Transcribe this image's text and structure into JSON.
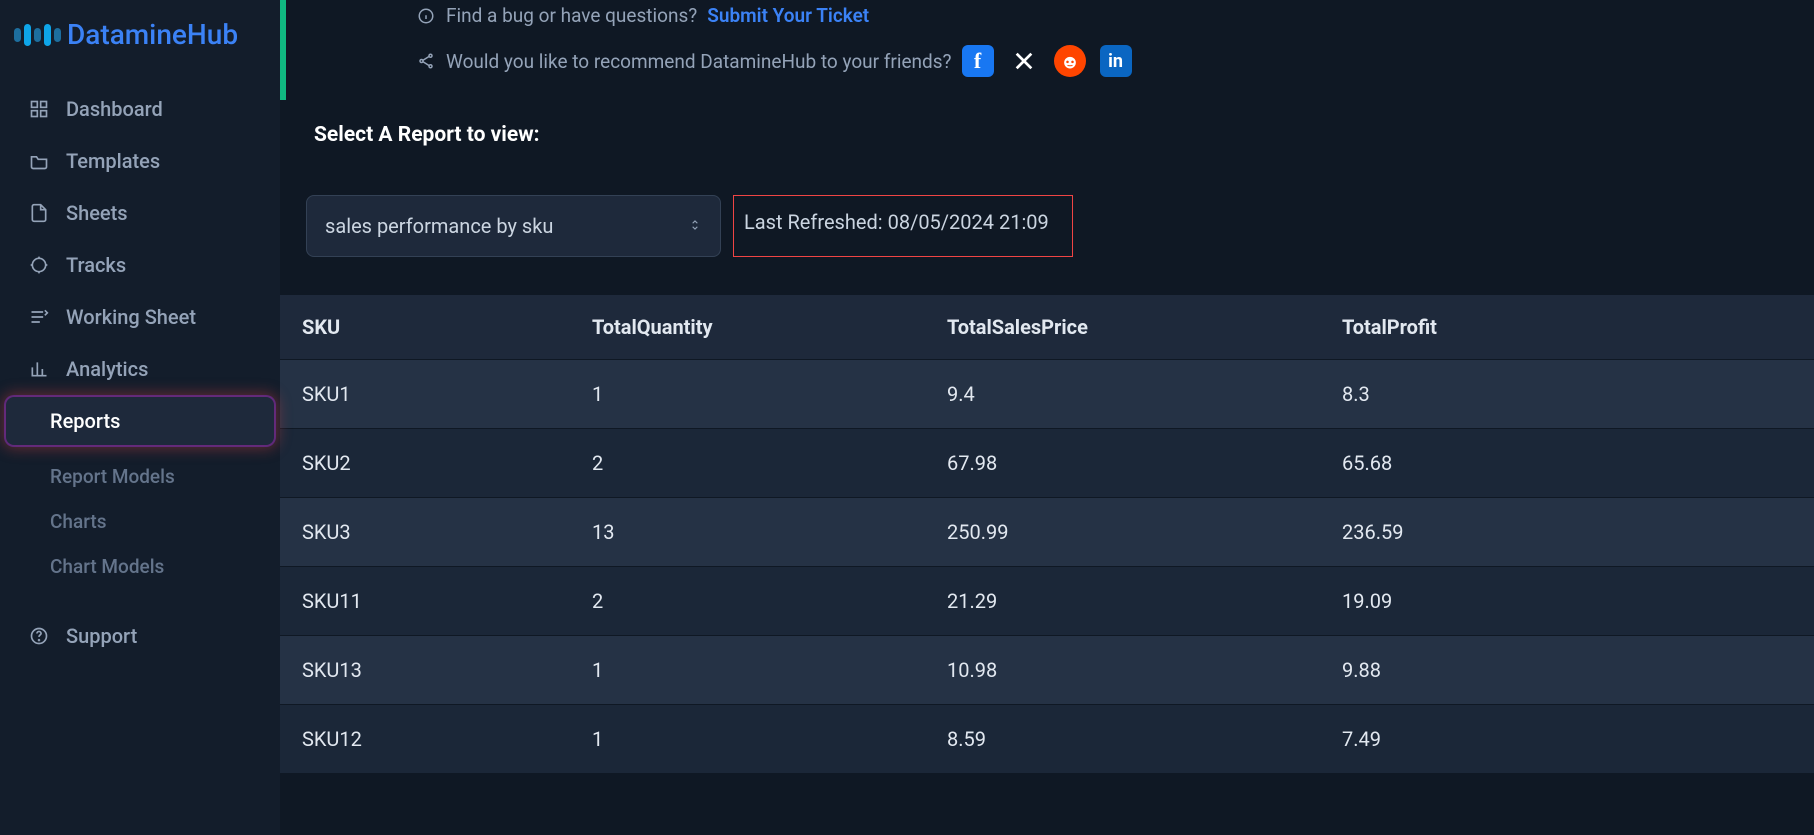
{
  "brand": {
    "name": "DatamineHub"
  },
  "sidebar": {
    "items": [
      {
        "label": "Dashboard"
      },
      {
        "label": "Templates"
      },
      {
        "label": "Sheets"
      },
      {
        "label": "Tracks"
      },
      {
        "label": "Working Sheet"
      },
      {
        "label": "Analytics"
      },
      {
        "label": "Reports"
      },
      {
        "label": "Report Models"
      },
      {
        "label": "Charts"
      },
      {
        "label": "Chart Models"
      }
    ],
    "support": "Support"
  },
  "top": {
    "bug_text": "Find a bug or have questions?",
    "submit_link": "Submit Your Ticket",
    "recommend_text": "Would you like to recommend DatamineHub to your friends?"
  },
  "report": {
    "section_label": "Select A Report to view:",
    "selected": "sales performance by sku",
    "last_refreshed": "Last Refreshed: 08/05/2024 21:09"
  },
  "table": {
    "headers": [
      "SKU",
      "TotalQuantity",
      "TotalSalesPrice",
      "TotalProfit"
    ],
    "rows": [
      [
        "SKU1",
        "1",
        "9.4",
        "8.3"
      ],
      [
        "SKU2",
        "2",
        "67.98",
        "65.68"
      ],
      [
        "SKU3",
        "13",
        "250.99",
        "236.59"
      ],
      [
        "SKU11",
        "2",
        "21.29",
        "19.09"
      ],
      [
        "SKU13",
        "1",
        "10.98",
        "9.88"
      ],
      [
        "SKU12",
        "1",
        "8.59",
        "7.49"
      ]
    ]
  }
}
